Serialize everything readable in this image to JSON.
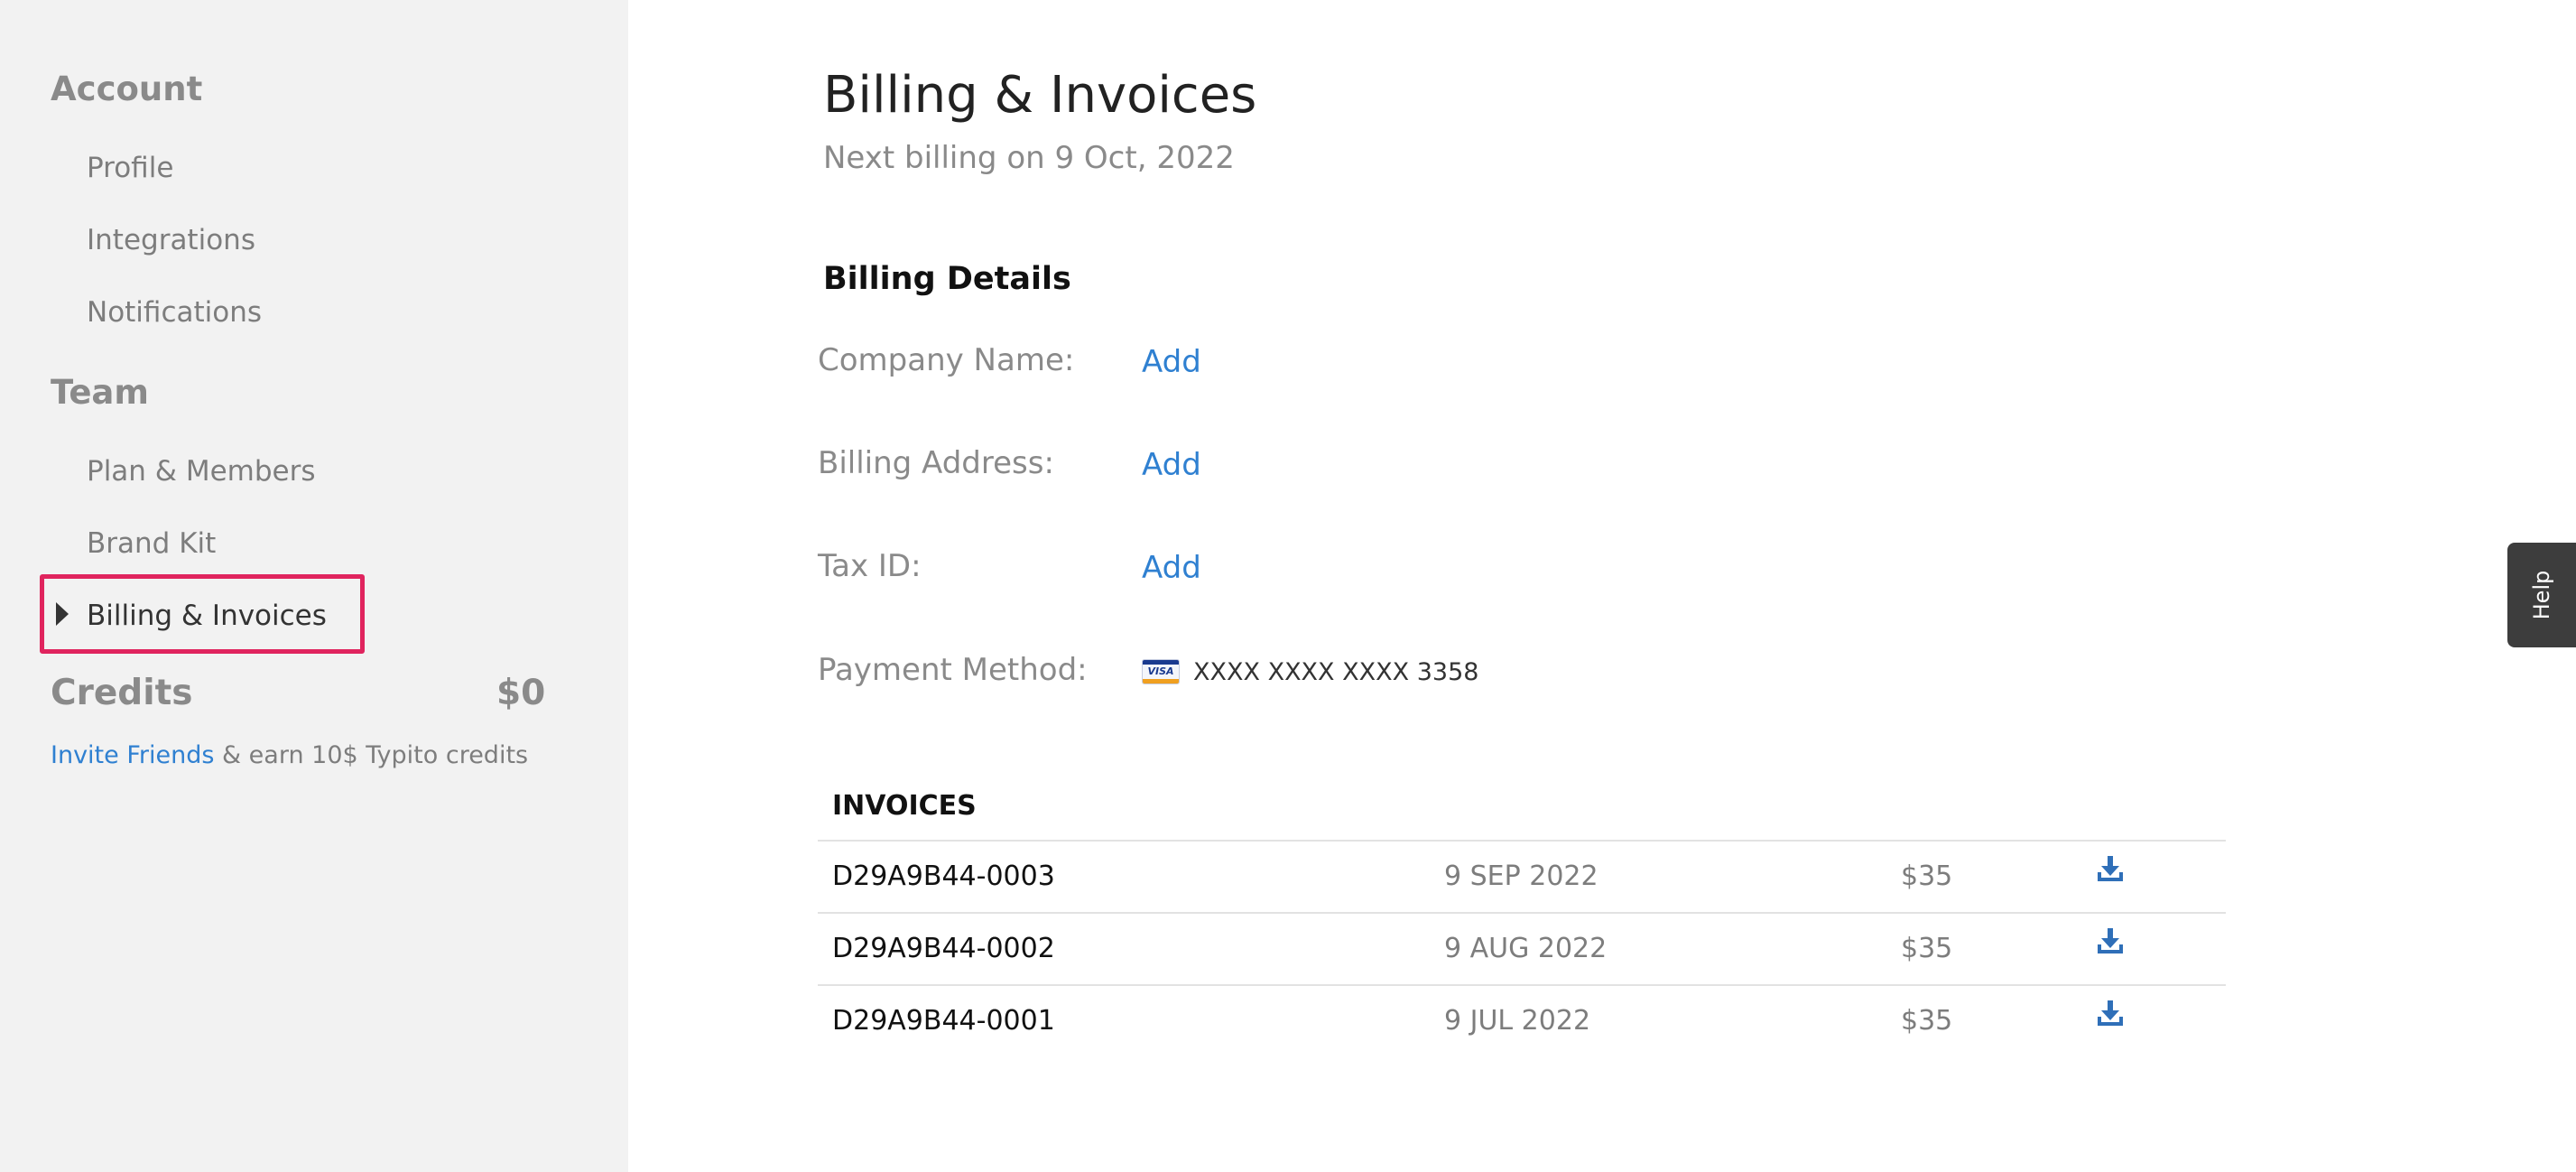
{
  "sidebar": {
    "account_heading": "Account",
    "account_items": [
      "Profile",
      "Integrations",
      "Notifications"
    ],
    "team_heading": "Team",
    "team_items": [
      "Plan & Members",
      "Brand Kit",
      "Billing & Invoices"
    ],
    "active_item": "Billing & Invoices",
    "credits_label": "Credits",
    "credits_value": "$0",
    "invite_link": "Invite Friends",
    "invite_text": " & earn 10$ Typito credits"
  },
  "main": {
    "title": "Billing & Invoices",
    "subtitle": "Next billing on 9 Oct, 2022",
    "billing_details_title": "Billing Details",
    "details": [
      {
        "label": "Company Name:",
        "action": "Add"
      },
      {
        "label": "Billing Address:",
        "action": "Add"
      },
      {
        "label": "Tax ID:",
        "action": "Add"
      }
    ],
    "payment_method_label": "Payment Method:",
    "payment_card_brand": "VISA",
    "payment_card_number": "XXXX XXXX XXXX 3358",
    "invoices_title": "INVOICES",
    "invoices": [
      {
        "id": "D29A9B44-0003",
        "date": "9 SEP 2022",
        "amount": "$35",
        "icon": "download-icon"
      },
      {
        "id": "D29A9B44-0002",
        "date": "9 AUG 2022",
        "amount": "$35",
        "icon": "download-icon"
      },
      {
        "id": "D29A9B44-0001",
        "date": "9 JUL 2022",
        "amount": "$35",
        "icon": "download-icon"
      }
    ]
  },
  "help_tab": {
    "label": "Help"
  },
  "colors": {
    "accent": "#2f80d1",
    "active_highlight": "#e0245e",
    "sidebar_bg": "#f2f2f2",
    "help_bg": "#3d3d3d"
  }
}
